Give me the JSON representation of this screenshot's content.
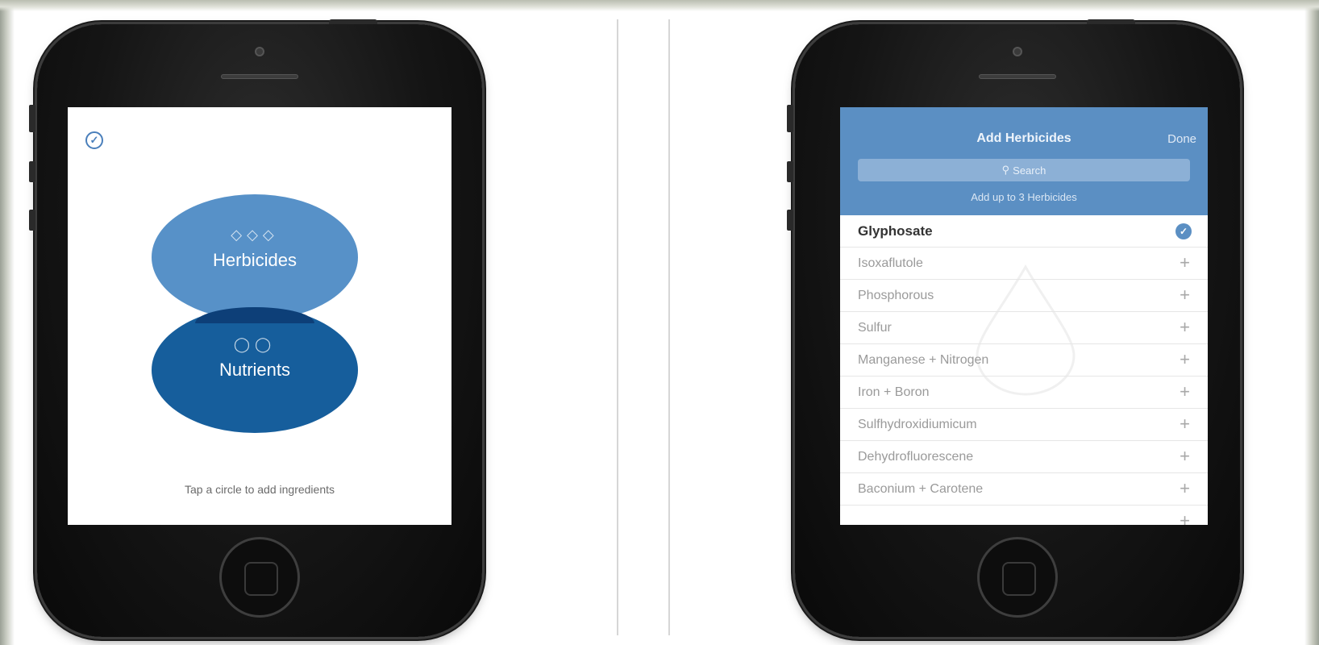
{
  "screen1": {
    "check_icon": "✓",
    "herbicides": {
      "label": "Herbicides",
      "icons": "◇◇◇",
      "color": "#3a7ebe"
    },
    "nutrients": {
      "label": "Nutrients",
      "icons": "◯◯",
      "color": "#165e9c"
    },
    "hint": "Tap a circle to add ingredients"
  },
  "screen2": {
    "nav": {
      "title": "Add Herbicides",
      "done": "Done",
      "search_icon": "⚲",
      "search_placeholder": "Search",
      "subtitle": "Add up to 3 Herbicides",
      "color": "#5b8fc3"
    },
    "items": [
      {
        "label": "Glyphosate",
        "selected": true,
        "action": "✓"
      },
      {
        "label": "Isoxaflutole",
        "action": "+"
      },
      {
        "label": "Phosphorous",
        "action": "+"
      },
      {
        "label": "Sulfur",
        "action": "+"
      },
      {
        "label": "Manganese + Nitrogen",
        "action": "+"
      },
      {
        "label": "Iron + Boron",
        "action": "+"
      },
      {
        "label": "Sulfhydroxidiumicum",
        "action": "+"
      },
      {
        "label": "Dehydrofluorescene",
        "action": "+"
      },
      {
        "label": "Baconium + Carotene",
        "action": "+"
      },
      {
        "label": "",
        "action": "+"
      }
    ]
  }
}
